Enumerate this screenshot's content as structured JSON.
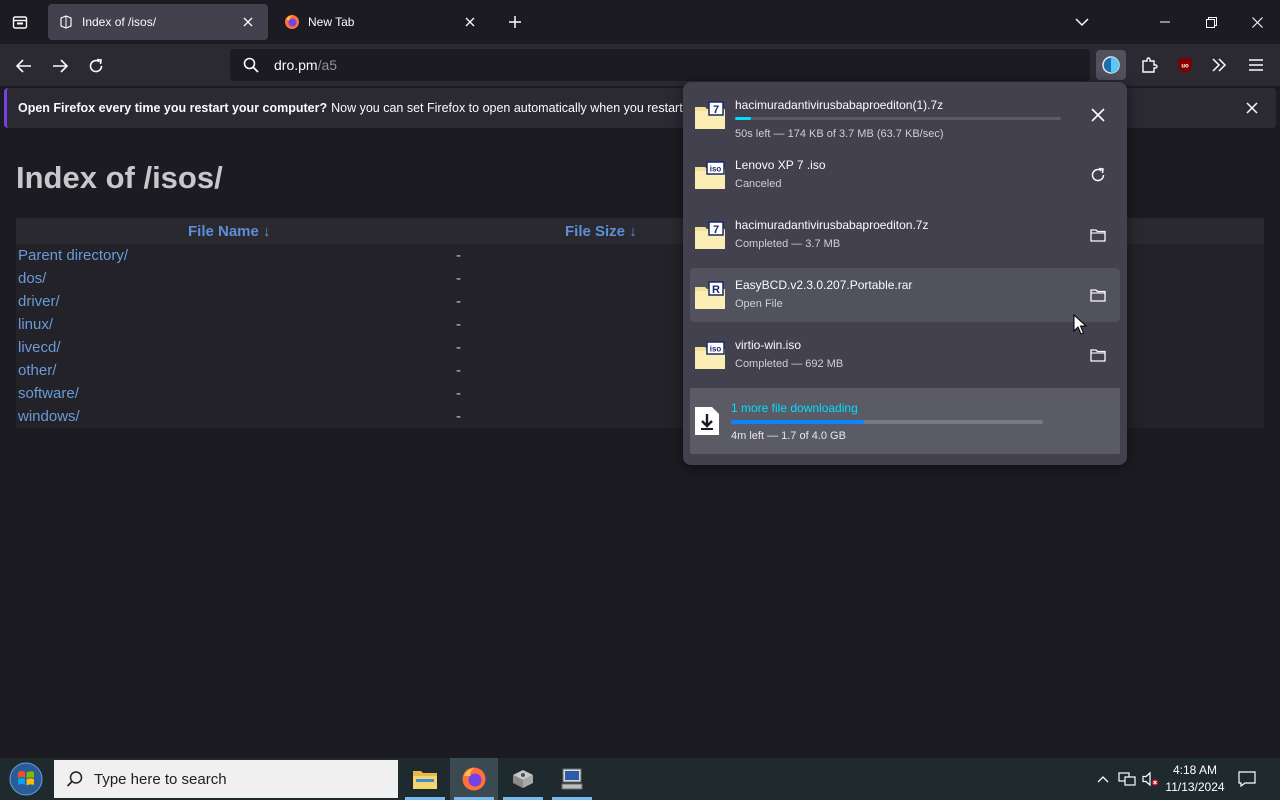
{
  "tabs": [
    {
      "title": "Index of /isos/",
      "active": true
    },
    {
      "title": "New Tab",
      "active": false
    }
  ],
  "urlbar": {
    "host": "dro.pm",
    "path": "/a5"
  },
  "notification": {
    "bold": "Open Firefox every time you restart your computer?",
    "text": "Now you can set Firefox to open automatically when you restart your c"
  },
  "page": {
    "title": "Index of /isos/",
    "headers": {
      "name": "File Name  ↓",
      "size": "File Size  ↓"
    },
    "rows": [
      {
        "name": "Parent directory/",
        "size": "-"
      },
      {
        "name": "dos/",
        "size": "-"
      },
      {
        "name": "driver/",
        "size": "-"
      },
      {
        "name": "linux/",
        "size": "-"
      },
      {
        "name": "livecd/",
        "size": "-"
      },
      {
        "name": "other/",
        "size": "-"
      },
      {
        "name": "software/",
        "size": "-"
      },
      {
        "name": "windows/",
        "size": "-"
      }
    ]
  },
  "downloads": {
    "items": [
      {
        "name": "hacimuradantivirusbabaproediton(1).7z",
        "status": "50s left — 174 KB of 3.7 MB (63.7 KB/sec)",
        "icon": "7z-archive-icon",
        "action": "cancel",
        "progress": 0.05
      },
      {
        "name": "Lenovo XP 7 .iso",
        "status": "Canceled",
        "icon": "iso-file-icon",
        "action": "retry"
      },
      {
        "name": "hacimuradantivirusbabaproediton.7z",
        "status": "Completed — 3.7 MB",
        "icon": "7z-archive-icon",
        "action": "show-in-folder"
      },
      {
        "name": "EasyBCD.v2.3.0.207.Portable.rar",
        "status": "Open File",
        "icon": "rar-archive-icon",
        "action": "show-in-folder"
      },
      {
        "name": "virtio-win.iso",
        "status": "Completed — 692 MB",
        "icon": "iso-file-icon",
        "action": "show-in-folder"
      }
    ],
    "summary": {
      "label": "1 more file downloading",
      "status": "4m left — 1.7 of 4.0 GB",
      "progress": 0.425
    }
  },
  "taskbar": {
    "search_placeholder": "Type here to search",
    "time": "4:18 AM",
    "date": "11/13/2024"
  },
  "colors": {
    "accent": "#00ddff",
    "progress": "#0a84ff",
    "link": "#6a9ad8",
    "notify_border": "#7542e5"
  }
}
